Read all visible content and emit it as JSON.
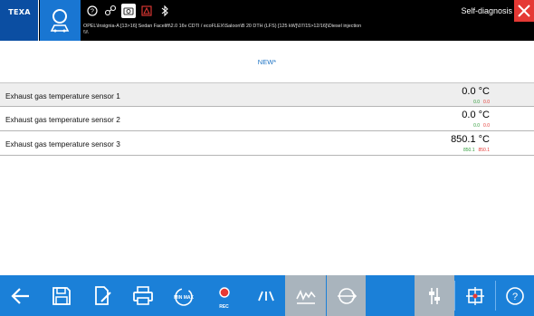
{
  "header": {
    "logo": "TEXA",
    "title": "Self-diagnosis",
    "vehicle_line": "OPEL\\Insignia-A [13>16] Sedan Facelift\\2.0 16v CDTI / ecoFLEX\\Saloon\\B 20 DTH (LFS) [125 kW]\\07/15>12/16]\\Diesel injection",
    "vehicle_sub": "\\\\\\\\",
    "icons": [
      "help-icon",
      "connection-icon",
      "screenshot-icon",
      "warning-icon",
      "bluetooth-icon",
      "close-icon"
    ]
  },
  "main": {
    "section_title": "NEW*",
    "rows": [
      {
        "label": "Exhaust gas temperature sensor 1",
        "value": "0.0 °C",
        "min": "0.0",
        "max": "0.0"
      },
      {
        "label": "Exhaust gas temperature sensor 2",
        "value": "0.0 °C",
        "min": "0.0",
        "max": "0.0"
      },
      {
        "label": "Exhaust gas temperature sensor 3",
        "value": "850.1 °C",
        "min": "850.1",
        "max": "850.1"
      }
    ]
  },
  "toolbar": {
    "rec_label": "REC",
    "minmax_label": "MIN MAX",
    "buttons": [
      "back-arrow-icon",
      "save-icon",
      "edit-document-icon",
      "print-icon",
      "min-max-icon",
      "rec-icon",
      "signals-icon",
      "chart-icon",
      "routing-icon",
      "adjust-icon",
      "target-icon",
      "help-icon"
    ]
  },
  "colors": {
    "header_bg": "#000000",
    "logo_blue": "#0b4ea2",
    "accent_blue": "#1b80d8",
    "close_red": "#e53935",
    "min_green": "#2e9c3a",
    "max_red": "#e53935",
    "disabled_gray": "#a9b4bd"
  }
}
